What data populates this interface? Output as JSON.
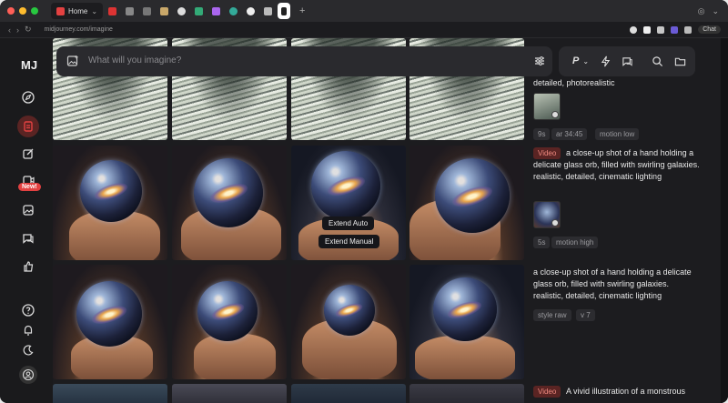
{
  "browser": {
    "home_tab_label": "Home",
    "url": "midjourney.com/imagine",
    "chat_label": "Chat",
    "traffic_colors": [
      "#ff5f57",
      "#febc2e",
      "#28c840"
    ]
  },
  "sidebar": {
    "logo": "MJ",
    "new_badge": "New!",
    "items": [
      "explore-icon",
      "create-icon",
      "edit-icon",
      "video-icon",
      "organize-icon",
      "chat-icon",
      "rate-icon",
      "help-icon",
      "notifications-icon",
      "theme-icon",
      "account-icon"
    ]
  },
  "search": {
    "placeholder": "What will you imagine?"
  },
  "toolbar": {
    "personalize_label": "P"
  },
  "grid": {
    "context_menu": {
      "extend_auto": "Extend Auto",
      "extend_manual": "Extend Manual"
    }
  },
  "panel": {
    "entries": [
      {
        "prompt_tail": "detailed, photorealistic",
        "tags": [
          "9s",
          "ar 34:45",
          "motion low"
        ]
      },
      {
        "badge": "Video",
        "prompt": "a close-up shot of a hand holding a delicate glass orb, filled with swirling galaxies. realistic, detailed, cinematic lighting",
        "tags": [
          "5s",
          "motion high"
        ]
      },
      {
        "prompt": "a close-up shot of a hand holding a delicate glass orb, filled with swirling galaxies. realistic, detailed, cinematic lighting",
        "tags": [
          "style raw",
          "v 7"
        ]
      },
      {
        "badge": "Video",
        "prompt": "A vivid illustration of a monstrous"
      }
    ]
  },
  "colors": {
    "accent": "#e34141",
    "background": "#1c1c1f"
  }
}
